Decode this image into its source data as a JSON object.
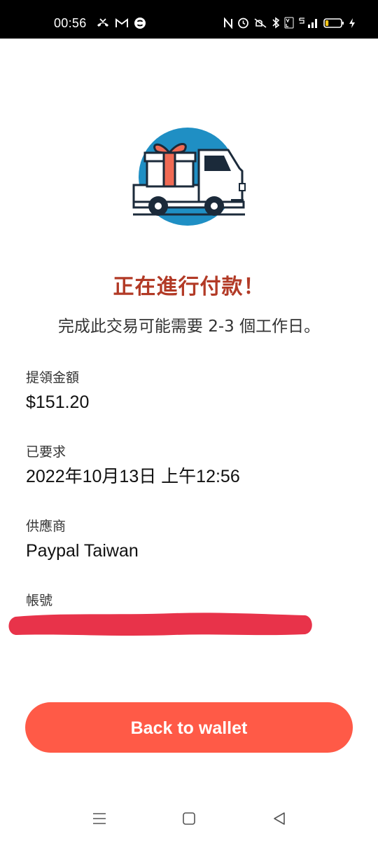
{
  "status_bar": {
    "time": "00:56",
    "left_icons": [
      "missed-call-icon",
      "gmail-icon",
      "shazam-icon"
    ],
    "right_icons": [
      "nfc-icon",
      "alarm-icon",
      "mute-icon",
      "bluetooth-icon",
      "volte-icon",
      "5g-signal-icon",
      "battery-icon",
      "charging-icon"
    ],
    "battery_level": 0.2
  },
  "colors": {
    "headline": "#b23a26",
    "button": "#ff5a47",
    "redaction": "#e8334a",
    "illustration_circle": "#1f8fc4"
  },
  "content": {
    "headline": "正在進行付款！",
    "subline": "完成此交易可能需要 2-3 個工作日。"
  },
  "details": [
    {
      "label": "提領金額",
      "value": "$151.20"
    },
    {
      "label": "已要求",
      "value": "2022年10月13日 上午12:56"
    },
    {
      "label": "供應商",
      "value": "Paypal Taiwan"
    },
    {
      "label": "帳號",
      "value": ""
    }
  ],
  "actions": {
    "back_label": "Back to wallet"
  },
  "nav": {
    "icons": [
      "menu-icon",
      "home-icon",
      "back-icon"
    ]
  }
}
